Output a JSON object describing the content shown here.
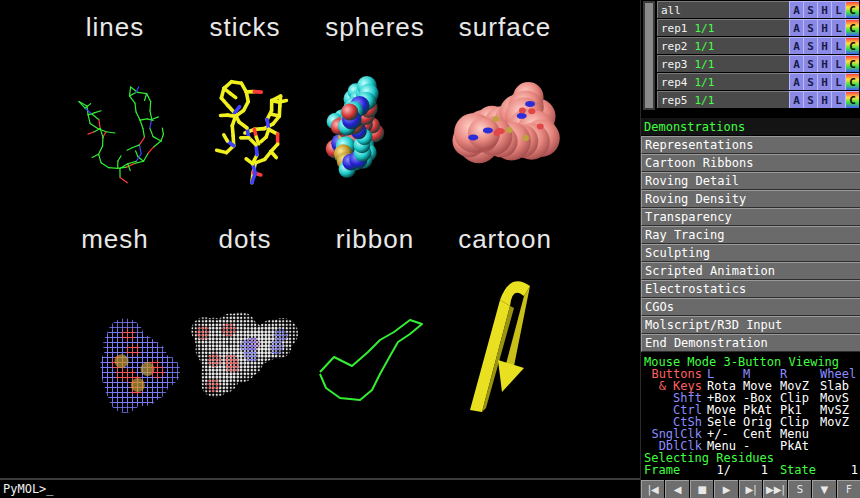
{
  "viewport": {
    "panels": [
      {
        "label": "lines",
        "kind": "wire"
      },
      {
        "label": "sticks",
        "kind": "stick"
      },
      {
        "label": "spheres",
        "kind": "ball"
      },
      {
        "label": "surface",
        "kind": "skin"
      },
      {
        "label": "mesh",
        "kind": "net"
      },
      {
        "label": "dots",
        "kind": "dot"
      },
      {
        "label": "ribbon",
        "kind": "trace"
      },
      {
        "label": "cartoon",
        "kind": "strand"
      }
    ]
  },
  "command_line": {
    "prompt": "PyMOL>_"
  },
  "object_list": {
    "buttons": [
      "A",
      "S",
      "H",
      "L",
      "C"
    ],
    "rows": [
      {
        "name": "all"
      },
      {
        "name": "rep1",
        "state": "1/1"
      },
      {
        "name": "rep2",
        "state": "1/1"
      },
      {
        "name": "rep3",
        "state": "1/1"
      },
      {
        "name": "rep4",
        "state": "1/1"
      },
      {
        "name": "rep5",
        "state": "1/1"
      }
    ]
  },
  "menu": {
    "title": "Demonstrations",
    "items": [
      "Representations",
      "Cartoon Ribbons",
      "Roving Detail",
      "Roving Density",
      "Transparency",
      "Ray Tracing",
      "Sculpting",
      "Scripted Animation",
      "Electrostatics",
      "CGOs",
      "Molscript/R3D Input",
      "End Demonstration"
    ]
  },
  "mouse_mode": {
    "title": "Mouse Mode 3-Button Viewing",
    "header": {
      "label": "Buttons",
      "color": "#ff6060",
      "columns": [
        "L",
        "M",
        "R",
        "Wheel"
      ]
    },
    "rows": [
      {
        "label": "& Keys",
        "color": "#ff6060",
        "cells": [
          "Rota",
          "Move",
          "MovZ",
          "Slab"
        ]
      },
      {
        "label": "Shft",
        "color": "#8c8cff",
        "cells": [
          "+Box",
          "-Box",
          "Clip",
          "MovS"
        ]
      },
      {
        "label": "Ctrl",
        "color": "#8c8cff",
        "cells": [
          "Move",
          "PkAt",
          "Pk1",
          "MvSZ"
        ]
      },
      {
        "label": "CtSh",
        "color": "#8c8cff",
        "cells": [
          "Sele",
          "Orig",
          "Clip",
          "MovZ"
        ]
      },
      {
        "label": "SnglClk",
        "color": "#8c8cff",
        "cells": [
          "+/-",
          "Cent",
          "Menu"
        ]
      },
      {
        "label": "DblClk",
        "color": "#8c8cff",
        "cells": [
          "Menu",
          "-",
          "PkAt"
        ]
      }
    ],
    "selecting": "Selecting Residues",
    "frame": {
      "frame_label": "Frame",
      "frame": "1/",
      "frame_count": "1",
      "state_label": "State",
      "state": "1"
    }
  },
  "controls": [
    "|◀",
    "◀",
    "■",
    "▶",
    "▶|",
    "▶▶|",
    "S",
    "▼",
    "F"
  ]
}
